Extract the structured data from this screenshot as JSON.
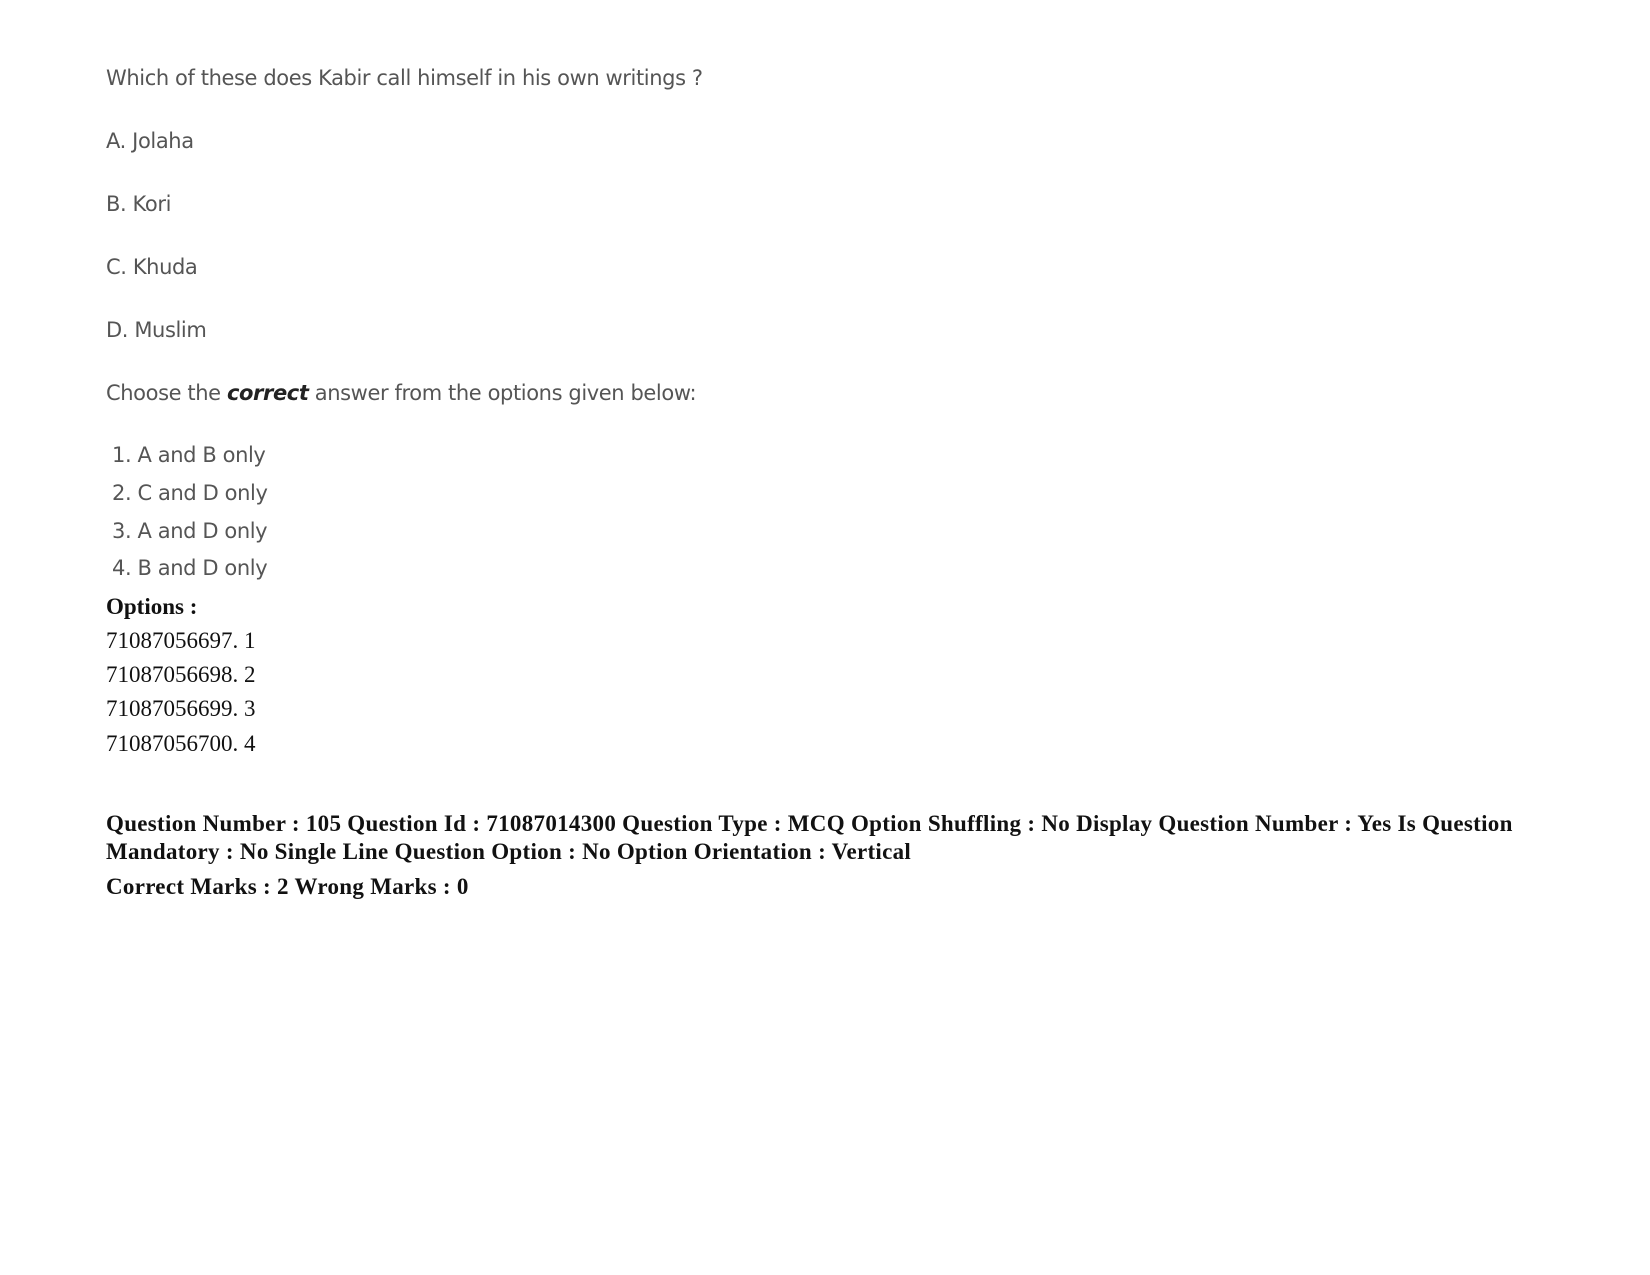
{
  "question": {
    "text": "Which of these does Kabir call himself in his own writings ?",
    "statements": [
      "A. Jolaha",
      "B. Kori",
      "C. Khuda",
      "D. Muslim"
    ],
    "instruction": {
      "prefix": "Choose the ",
      "emphasis": "correct",
      "suffix": " answer from the options given below:"
    },
    "choices": [
      "1. A and B only",
      "2. C and D only",
      "3. A and D only",
      "4. B and D only"
    ]
  },
  "options": {
    "label": "Options :",
    "items": [
      "71087056697. 1",
      "71087056698. 2",
      "71087056699. 3",
      "71087056700. 4"
    ]
  },
  "metadata": {
    "line": "Question Number : 105 Question Id : 71087014300 Question Type : MCQ Option Shuffling : No Display Question Number : Yes Is Question Mandatory : No Single Line Question Option : No Option Orientation : Vertical",
    "marks": "Correct Marks : 2 Wrong Marks : 0"
  }
}
